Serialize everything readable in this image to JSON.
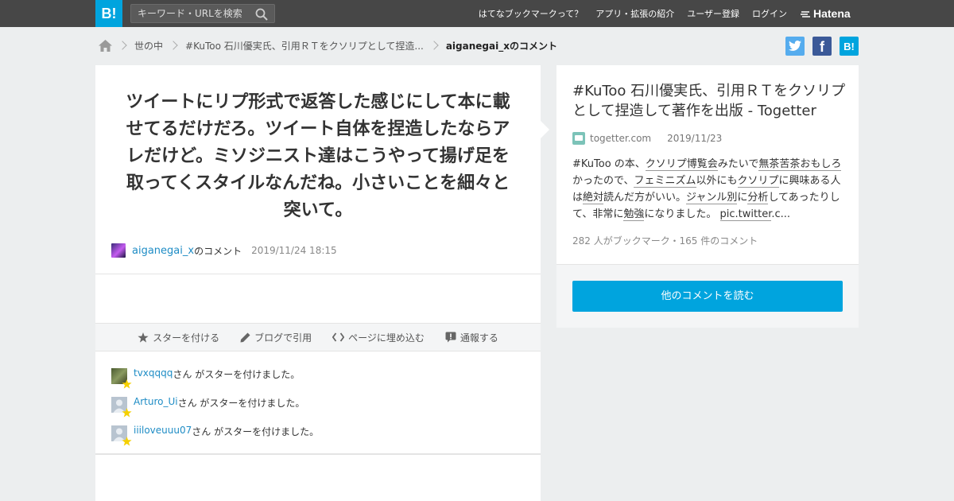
{
  "header": {
    "logo_text": "B!",
    "search_placeholder": "キーワード・URLを検索",
    "nav": [
      "はてなブックマークって？",
      "アプリ・拡張の紹介",
      "ユーザー登録",
      "ログイン"
    ],
    "hatena_label": "Hatena",
    "bar_color": "#474747",
    "brand_color": "#00a4de"
  },
  "breadcrumb": {
    "items": [
      "世の中",
      "#KuToo 石川優実氏、引用ＲＴをクソリプとして捏造...",
      "aiganegai_xのコメント"
    ]
  },
  "share": {
    "twitter_color": "#55acee",
    "facebook_color": "#3b5998",
    "hatena_color": "#00a4de",
    "facebook_label": "f",
    "hatena_label": "B!"
  },
  "comment": {
    "text": "ツイートにリプ形式で返答した感じにして本に載せてるだけだろ。ツイート自体を捏造したならアレだけど。ミソジニスト達はこうやって揚げ足を取ってくスタイルなんだね。小さいことを細々と突いて。",
    "user": "aiganegai_x",
    "user_suffix": "のコメント",
    "date": "2019/11/24 18:15"
  },
  "actions": {
    "star": "スターを付ける",
    "blog": "ブログで引用",
    "embed": "ページに埋め込む",
    "report": "通報する"
  },
  "stars": [
    {
      "user": "tvxqqqq",
      "text": "さん がスターを付けました。"
    },
    {
      "user": "Arturo_Ui",
      "text": "さん がスターを付けました。"
    },
    {
      "user": "iiiloveuuu07",
      "text": "さん がスターを付けました。"
    }
  ],
  "entry": {
    "title": "#KuToo 石川優実氏、引用ＲＴをクソリプとして捏造して著作を出版 - Togetter",
    "site": "togetter.com",
    "date": "2019/11/23",
    "summary": {
      "s1": "#KuToo の本、",
      "k1": "クソリプ博覧会",
      "s2": "みたいで",
      "k2": "無茶苦茶おもしろ",
      "s3": "かったので、",
      "k3": "フェミニズム",
      "s4": "以外にも",
      "k4": "クソリプ",
      "s5": "に興味ある人は",
      "k5": "絶対",
      "s6": "読んだ方がいい。",
      "k6": "ジャンル別",
      "s7": "に",
      "k7": "分析",
      "s8": "してあったりして、非常に",
      "k8": "勉強",
      "s9": "になりました。 ",
      "k9": "pic.twitter",
      "s10": ".c..."
    },
    "counts": "282 人がブックマーク・165 件のコメント",
    "read_button": "他のコメントを読む"
  }
}
